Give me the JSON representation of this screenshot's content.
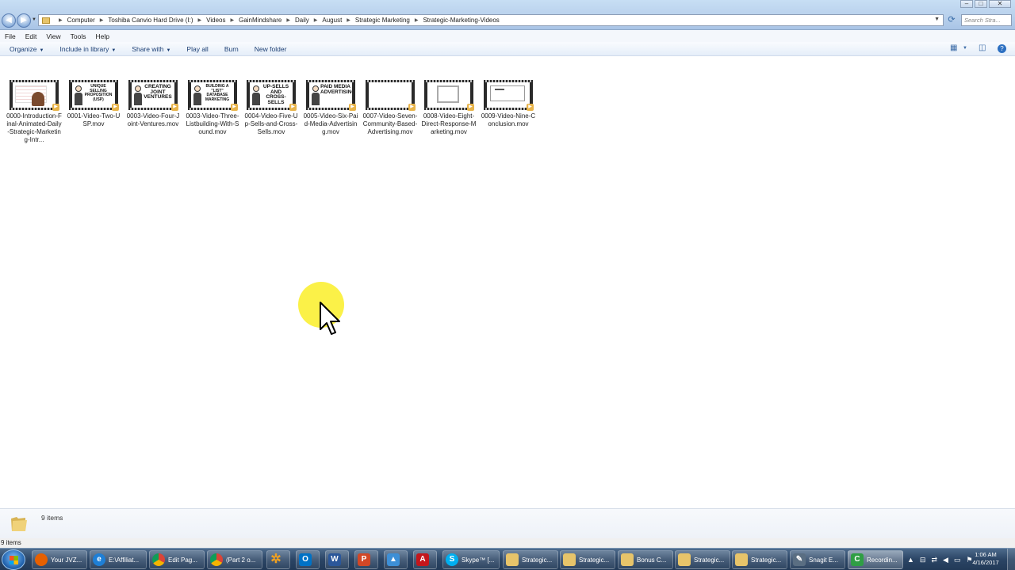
{
  "address_bar": {
    "path": [
      "Computer",
      "Toshiba Canvio Hard Drive (I:)",
      "Videos",
      "GainMindshare",
      "Daily",
      "August",
      "Strategic Marketing",
      "Strategic-Marketing-Videos"
    ]
  },
  "search": {
    "placeholder": "Search Stra..."
  },
  "menu": [
    "File",
    "Edit",
    "View",
    "Tools",
    "Help"
  ],
  "commands": {
    "organize": "Organize",
    "include_in_library": "Include in library",
    "share_with": "Share with",
    "play_all": "Play all",
    "burn": "Burn",
    "new_folder": "New folder"
  },
  "files": [
    {
      "name": "0000-Introduction-Final-Animated-Daily-Strategic-Marketing-Intr...",
      "thumb_text": ""
    },
    {
      "name": "0001-Video-Two-USP.mov",
      "thumb_text": "UNIQUE SELLING PROPOSITION (USP)"
    },
    {
      "name": "0003-Video-Four-Joint-Ventures.mov",
      "thumb_text": "CREATING JOINT VENTURES"
    },
    {
      "name": "0003-Video-Three-Listbuilding-With-Sound.mov",
      "thumb_text": "BUILDING A \"LIST\" DATABASE MARKETING"
    },
    {
      "name": "0004-Video-Five-Up-Sells-and-Cross-Sells.mov",
      "thumb_text": "UP-SELLS AND CROSS-SELLS"
    },
    {
      "name": "0005-Video-Six-Paid-Media-Advertising.mov",
      "thumb_text": "PAID MEDIA ADVERTISING"
    },
    {
      "name": "0007-Video-Seven-Community-Based-Advertising.mov",
      "thumb_text": ""
    },
    {
      "name": "0008-Video-Eight-Direct-Response-Marketing.mov",
      "thumb_text": ""
    },
    {
      "name": "0009-Video-Nine-Conclusion.mov",
      "thumb_text": ""
    }
  ],
  "details_pane": {
    "item_count": "9 items"
  },
  "status_bar": {
    "text": "9 items"
  },
  "taskbar": {
    "items": [
      {
        "label": "Your JVZ...",
        "icon": "firefox-icon",
        "color": "#e66000"
      },
      {
        "label": "E:\\Affiliat...",
        "icon": "internet-explorer-icon",
        "color": "#1e7fd6"
      },
      {
        "label": "Edit Pag...",
        "icon": "chrome-icon",
        "color": "#db4437"
      },
      {
        "label": "(Part 2 o...",
        "icon": "chrome-icon",
        "color": "#db4437"
      },
      {
        "label": "",
        "icon": "pinwheel-icon",
        "color": "#f0a020"
      },
      {
        "label": "",
        "icon": "outlook-icon",
        "color": "#0072c6"
      },
      {
        "label": "",
        "icon": "word-icon",
        "color": "#2b579a"
      },
      {
        "label": "",
        "icon": "powerpoint-icon",
        "color": "#d24726"
      },
      {
        "label": "",
        "icon": "upload-icon",
        "color": "#3d8fd6"
      },
      {
        "label": "",
        "icon": "acrobat-icon",
        "color": "#c4161c"
      },
      {
        "label": "Skype™ [...",
        "icon": "skype-icon",
        "color": "#00aff0"
      },
      {
        "label": "Strategic...",
        "icon": "folder-icon",
        "color": "#e7c46a"
      },
      {
        "label": "Strategic...",
        "icon": "folder-icon",
        "color": "#e7c46a"
      },
      {
        "label": "Bonus C...",
        "icon": "folder-icon",
        "color": "#e7c46a"
      },
      {
        "label": "Strategic...",
        "icon": "folder-icon",
        "color": "#e7c46a"
      },
      {
        "label": "Strategic...",
        "icon": "folder-icon",
        "color": "#e7c46a"
      },
      {
        "label": "Snagit E...",
        "icon": "snagit-edit-icon",
        "color": "#5a6e82"
      },
      {
        "label": "Recordin...",
        "icon": "camtasia-icon",
        "color": "#2f9e44"
      }
    ],
    "clock": {
      "time": "1:06 AM",
      "date": "4/16/2017"
    }
  }
}
